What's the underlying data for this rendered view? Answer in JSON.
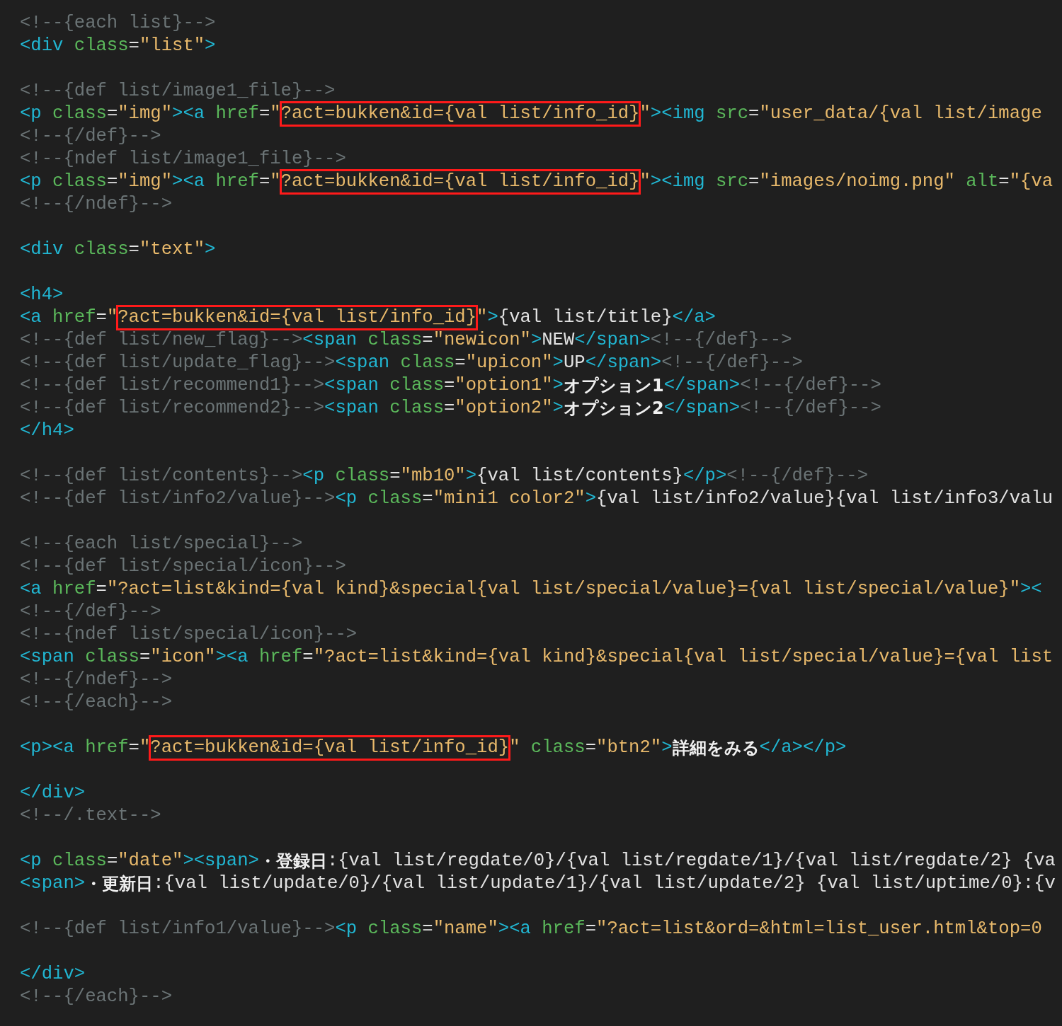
{
  "editor": {
    "lines": [
      {
        "kind": "code",
        "tokens": [
          {
            "kind": "comment",
            "text": "<!--{each list}-->"
          }
        ]
      },
      {
        "kind": "code",
        "tokens": [
          {
            "kind": "tag",
            "text": "<div"
          },
          {
            "kind": "attr",
            "text": " class"
          },
          {
            "kind": "text",
            "text": "="
          },
          {
            "kind": "string",
            "text": "\"list\""
          },
          {
            "kind": "tag",
            "text": ">"
          }
        ]
      },
      {
        "kind": "blank"
      },
      {
        "kind": "code",
        "tokens": [
          {
            "kind": "comment",
            "text": "<!--{def list/image1_file}-->"
          }
        ]
      },
      {
        "kind": "code",
        "tokens": [
          {
            "kind": "tag",
            "text": "<p"
          },
          {
            "kind": "attr",
            "text": " class"
          },
          {
            "kind": "text",
            "text": "="
          },
          {
            "kind": "string",
            "text": "\"img\""
          },
          {
            "kind": "tag",
            "text": "><a"
          },
          {
            "kind": "attr",
            "text": " href"
          },
          {
            "kind": "text",
            "text": "="
          },
          {
            "kind": "string",
            "text": "\""
          },
          {
            "kind": "highlight",
            "text": "?act=bukken&id={val list/info_id}"
          },
          {
            "kind": "string",
            "text": "\""
          },
          {
            "kind": "tag",
            "text": "><img"
          },
          {
            "kind": "attr",
            "text": " src"
          },
          {
            "kind": "text",
            "text": "="
          },
          {
            "kind": "string",
            "text": "\"user_data/{val list/image"
          }
        ]
      },
      {
        "kind": "code",
        "tokens": [
          {
            "kind": "comment",
            "text": "<!--{/def}-->"
          }
        ]
      },
      {
        "kind": "code",
        "tokens": [
          {
            "kind": "comment",
            "text": "<!--{ndef list/image1_file}-->"
          }
        ]
      },
      {
        "kind": "code",
        "tokens": [
          {
            "kind": "tag",
            "text": "<p"
          },
          {
            "kind": "attr",
            "text": " class"
          },
          {
            "kind": "text",
            "text": "="
          },
          {
            "kind": "string",
            "text": "\"img\""
          },
          {
            "kind": "tag",
            "text": "><a"
          },
          {
            "kind": "attr",
            "text": " href"
          },
          {
            "kind": "text",
            "text": "="
          },
          {
            "kind": "string",
            "text": "\""
          },
          {
            "kind": "highlight",
            "text": "?act=bukken&id={val list/info_id}"
          },
          {
            "kind": "string",
            "text": "\""
          },
          {
            "kind": "tag",
            "text": "><img"
          },
          {
            "kind": "attr",
            "text": " src"
          },
          {
            "kind": "text",
            "text": "="
          },
          {
            "kind": "string",
            "text": "\"images/noimg.png\""
          },
          {
            "kind": "attr",
            "text": " alt"
          },
          {
            "kind": "text",
            "text": "="
          },
          {
            "kind": "string",
            "text": "\"{va"
          }
        ]
      },
      {
        "kind": "code",
        "tokens": [
          {
            "kind": "comment",
            "text": "<!--{/ndef}-->"
          }
        ]
      },
      {
        "kind": "blank"
      },
      {
        "kind": "code",
        "tokens": [
          {
            "kind": "tag",
            "text": "<div"
          },
          {
            "kind": "attr",
            "text": " class"
          },
          {
            "kind": "text",
            "text": "="
          },
          {
            "kind": "string",
            "text": "\"text\""
          },
          {
            "kind": "tag",
            "text": ">"
          }
        ]
      },
      {
        "kind": "blank"
      },
      {
        "kind": "code",
        "tokens": [
          {
            "kind": "tag",
            "text": "<h4>"
          }
        ]
      },
      {
        "kind": "code",
        "tokens": [
          {
            "kind": "tag",
            "text": "<a"
          },
          {
            "kind": "attr",
            "text": " href"
          },
          {
            "kind": "text",
            "text": "="
          },
          {
            "kind": "string",
            "text": "\""
          },
          {
            "kind": "highlight",
            "text": "?act=bukken&id={val list/info_id}"
          },
          {
            "kind": "string",
            "text": "\""
          },
          {
            "kind": "tag",
            "text": ">"
          },
          {
            "kind": "text",
            "text": "{val list/title}"
          },
          {
            "kind": "tag",
            "text": "</a>"
          }
        ]
      },
      {
        "kind": "code",
        "tokens": [
          {
            "kind": "comment",
            "text": "<!--{def list/new_flag}-->"
          },
          {
            "kind": "tag",
            "text": "<span"
          },
          {
            "kind": "attr",
            "text": " class"
          },
          {
            "kind": "text",
            "text": "="
          },
          {
            "kind": "string",
            "text": "\"newicon\""
          },
          {
            "kind": "tag",
            "text": ">"
          },
          {
            "kind": "text",
            "text": "NEW"
          },
          {
            "kind": "tag",
            "text": "</span>"
          },
          {
            "kind": "comment",
            "text": "<!--{/def}-->"
          }
        ]
      },
      {
        "kind": "code",
        "tokens": [
          {
            "kind": "comment",
            "text": "<!--{def list/update_flag}-->"
          },
          {
            "kind": "tag",
            "text": "<span"
          },
          {
            "kind": "attr",
            "text": " class"
          },
          {
            "kind": "text",
            "text": "="
          },
          {
            "kind": "string",
            "text": "\"upicon\""
          },
          {
            "kind": "tag",
            "text": ">"
          },
          {
            "kind": "text",
            "text": "UP"
          },
          {
            "kind": "tag",
            "text": "</span>"
          },
          {
            "kind": "comment",
            "text": "<!--{/def}-->"
          }
        ]
      },
      {
        "kind": "code",
        "tokens": [
          {
            "kind": "comment",
            "text": "<!--{def list/recommend1}-->"
          },
          {
            "kind": "tag",
            "text": "<span"
          },
          {
            "kind": "attr",
            "text": " class"
          },
          {
            "kind": "text",
            "text": "="
          },
          {
            "kind": "string",
            "text": "\"option1\""
          },
          {
            "kind": "tag",
            "text": ">"
          },
          {
            "kind": "bold",
            "text": "オプション1"
          },
          {
            "kind": "tag",
            "text": "</span>"
          },
          {
            "kind": "comment",
            "text": "<!--{/def}-->"
          }
        ]
      },
      {
        "kind": "code",
        "tokens": [
          {
            "kind": "comment",
            "text": "<!--{def list/recommend2}-->"
          },
          {
            "kind": "tag",
            "text": "<span"
          },
          {
            "kind": "attr",
            "text": " class"
          },
          {
            "kind": "text",
            "text": "="
          },
          {
            "kind": "string",
            "text": "\"option2\""
          },
          {
            "kind": "tag",
            "text": ">"
          },
          {
            "kind": "bold",
            "text": "オプション2"
          },
          {
            "kind": "tag",
            "text": "</span>"
          },
          {
            "kind": "comment",
            "text": "<!--{/def}-->"
          }
        ]
      },
      {
        "kind": "code",
        "tokens": [
          {
            "kind": "tag",
            "text": "</h4>"
          }
        ]
      },
      {
        "kind": "blank"
      },
      {
        "kind": "code",
        "tokens": [
          {
            "kind": "comment",
            "text": "<!--{def list/contents}-->"
          },
          {
            "kind": "tag",
            "text": "<p"
          },
          {
            "kind": "attr",
            "text": " class"
          },
          {
            "kind": "text",
            "text": "="
          },
          {
            "kind": "string",
            "text": "\"mb10\""
          },
          {
            "kind": "tag",
            "text": ">"
          },
          {
            "kind": "text",
            "text": "{val list/contents}"
          },
          {
            "kind": "tag",
            "text": "</p>"
          },
          {
            "kind": "comment",
            "text": "<!--{/def}-->"
          }
        ]
      },
      {
        "kind": "code",
        "tokens": [
          {
            "kind": "comment",
            "text": "<!--{def list/info2/value}-->"
          },
          {
            "kind": "tag",
            "text": "<p"
          },
          {
            "kind": "attr",
            "text": " class"
          },
          {
            "kind": "text",
            "text": "="
          },
          {
            "kind": "string",
            "text": "\"mini1 color2\""
          },
          {
            "kind": "tag",
            "text": ">"
          },
          {
            "kind": "text",
            "text": "{val list/info2/value}{val list/info3/valu"
          }
        ]
      },
      {
        "kind": "blank"
      },
      {
        "kind": "code",
        "tokens": [
          {
            "kind": "comment",
            "text": "<!--{each list/special}-->"
          }
        ]
      },
      {
        "kind": "code",
        "tokens": [
          {
            "kind": "comment",
            "text": "<!--{def list/special/icon}-->"
          }
        ]
      },
      {
        "kind": "code",
        "tokens": [
          {
            "kind": "tag",
            "text": "<a"
          },
          {
            "kind": "attr",
            "text": " href"
          },
          {
            "kind": "text",
            "text": "="
          },
          {
            "kind": "string",
            "text": "\"?act=list&kind={val kind}&special{val list/special/value}={val list/special/value}\""
          },
          {
            "kind": "tag",
            "text": "><"
          }
        ]
      },
      {
        "kind": "code",
        "tokens": [
          {
            "kind": "comment",
            "text": "<!--{/def}-->"
          }
        ]
      },
      {
        "kind": "code",
        "tokens": [
          {
            "kind": "comment",
            "text": "<!--{ndef list/special/icon}-->"
          }
        ]
      },
      {
        "kind": "code",
        "tokens": [
          {
            "kind": "tag",
            "text": "<span"
          },
          {
            "kind": "attr",
            "text": " class"
          },
          {
            "kind": "text",
            "text": "="
          },
          {
            "kind": "string",
            "text": "\"icon\""
          },
          {
            "kind": "tag",
            "text": "><a"
          },
          {
            "kind": "attr",
            "text": " href"
          },
          {
            "kind": "text",
            "text": "="
          },
          {
            "kind": "string",
            "text": "\"?act=list&kind={val kind}&special{val list/special/value}={val list"
          }
        ]
      },
      {
        "kind": "code",
        "tokens": [
          {
            "kind": "comment",
            "text": "<!--{/ndef}-->"
          }
        ]
      },
      {
        "kind": "code",
        "tokens": [
          {
            "kind": "comment",
            "text": "<!--{/each}-->"
          }
        ]
      },
      {
        "kind": "blank"
      },
      {
        "kind": "code",
        "tokens": [
          {
            "kind": "tag",
            "text": "<p><a"
          },
          {
            "kind": "attr",
            "text": " href"
          },
          {
            "kind": "text",
            "text": "="
          },
          {
            "kind": "string",
            "text": "\""
          },
          {
            "kind": "highlight",
            "text": "?act=bukken&id={val list/info_id}"
          },
          {
            "kind": "string",
            "text": "\""
          },
          {
            "kind": "attr",
            "text": " class"
          },
          {
            "kind": "text",
            "text": "="
          },
          {
            "kind": "string",
            "text": "\"btn2\""
          },
          {
            "kind": "tag",
            "text": ">"
          },
          {
            "kind": "bold",
            "text": "詳細をみる"
          },
          {
            "kind": "tag",
            "text": "</a></p>"
          }
        ]
      },
      {
        "kind": "blank"
      },
      {
        "kind": "code",
        "tokens": [
          {
            "kind": "tag",
            "text": "</div>"
          }
        ]
      },
      {
        "kind": "code",
        "tokens": [
          {
            "kind": "comment",
            "text": "<!--/.text-->"
          }
        ]
      },
      {
        "kind": "blank"
      },
      {
        "kind": "code",
        "tokens": [
          {
            "kind": "tag",
            "text": "<p"
          },
          {
            "kind": "attr",
            "text": " class"
          },
          {
            "kind": "text",
            "text": "="
          },
          {
            "kind": "string",
            "text": "\"date\""
          },
          {
            "kind": "tag",
            "text": "><span>"
          },
          {
            "kind": "bold",
            "text": "・登録日"
          },
          {
            "kind": "text",
            "text": ":{val list/regdate/0}/{val list/regdate/1}/{val list/regdate/2} {va"
          }
        ]
      },
      {
        "kind": "code",
        "tokens": [
          {
            "kind": "tag",
            "text": "<span>"
          },
          {
            "kind": "bold",
            "text": "・更新日"
          },
          {
            "kind": "text",
            "text": ":{val list/update/0}/{val list/update/1}/{val list/update/2} {val list/uptime/0}:{v"
          }
        ]
      },
      {
        "kind": "blank"
      },
      {
        "kind": "code",
        "tokens": [
          {
            "kind": "comment",
            "text": "<!--{def list/info1/value}-->"
          },
          {
            "kind": "tag",
            "text": "<p"
          },
          {
            "kind": "attr",
            "text": " class"
          },
          {
            "kind": "text",
            "text": "="
          },
          {
            "kind": "string",
            "text": "\"name\""
          },
          {
            "kind": "tag",
            "text": "><a"
          },
          {
            "kind": "attr",
            "text": " href"
          },
          {
            "kind": "text",
            "text": "="
          },
          {
            "kind": "string",
            "text": "\"?act=list&ord=&html=list_user.html&top=0"
          }
        ]
      },
      {
        "kind": "blank"
      },
      {
        "kind": "code",
        "tokens": [
          {
            "kind": "tag",
            "text": "</div>"
          }
        ]
      },
      {
        "kind": "code",
        "tokens": [
          {
            "kind": "comment",
            "text": "<!--{/each}-->"
          }
        ]
      }
    ]
  }
}
